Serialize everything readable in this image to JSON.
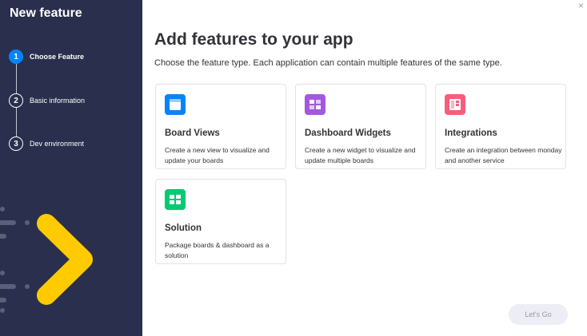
{
  "sidebar": {
    "title": "New feature",
    "steps": [
      {
        "number": "1",
        "label": "Choose Feature",
        "active": true
      },
      {
        "number": "2",
        "label": "Basic information",
        "active": false
      },
      {
        "number": "3",
        "label": "Dev environment",
        "active": false
      }
    ]
  },
  "main": {
    "title": "Add features to your app",
    "subtitle": "Choose the feature type. Each application can contain multiple features of the same type.",
    "close_icon": "×",
    "cards": [
      {
        "title": "Board Views",
        "description": "Create a new view to visualize and update your boards",
        "icon": "board-view-icon",
        "color": "#0085ff"
      },
      {
        "title": "Dashboard Widgets",
        "description": "Create a new widget to visualize and update multiple boards",
        "icon": "dashboard-widget-icon",
        "color": "#a358df"
      },
      {
        "title": "Integrations",
        "description": "Create an integration between monday and another service",
        "icon": "integration-icon",
        "color": "#f65f7c"
      },
      {
        "title": "Solution",
        "description": "Package boards & dashboard as a solution",
        "icon": "solution-icon",
        "color": "#00ca72"
      }
    ],
    "go_button": "Let's Go"
  },
  "colors": {
    "sidebar_bg": "#292f4c",
    "active_step": "#0085ff",
    "accent_arrow": "#ffcb00"
  }
}
